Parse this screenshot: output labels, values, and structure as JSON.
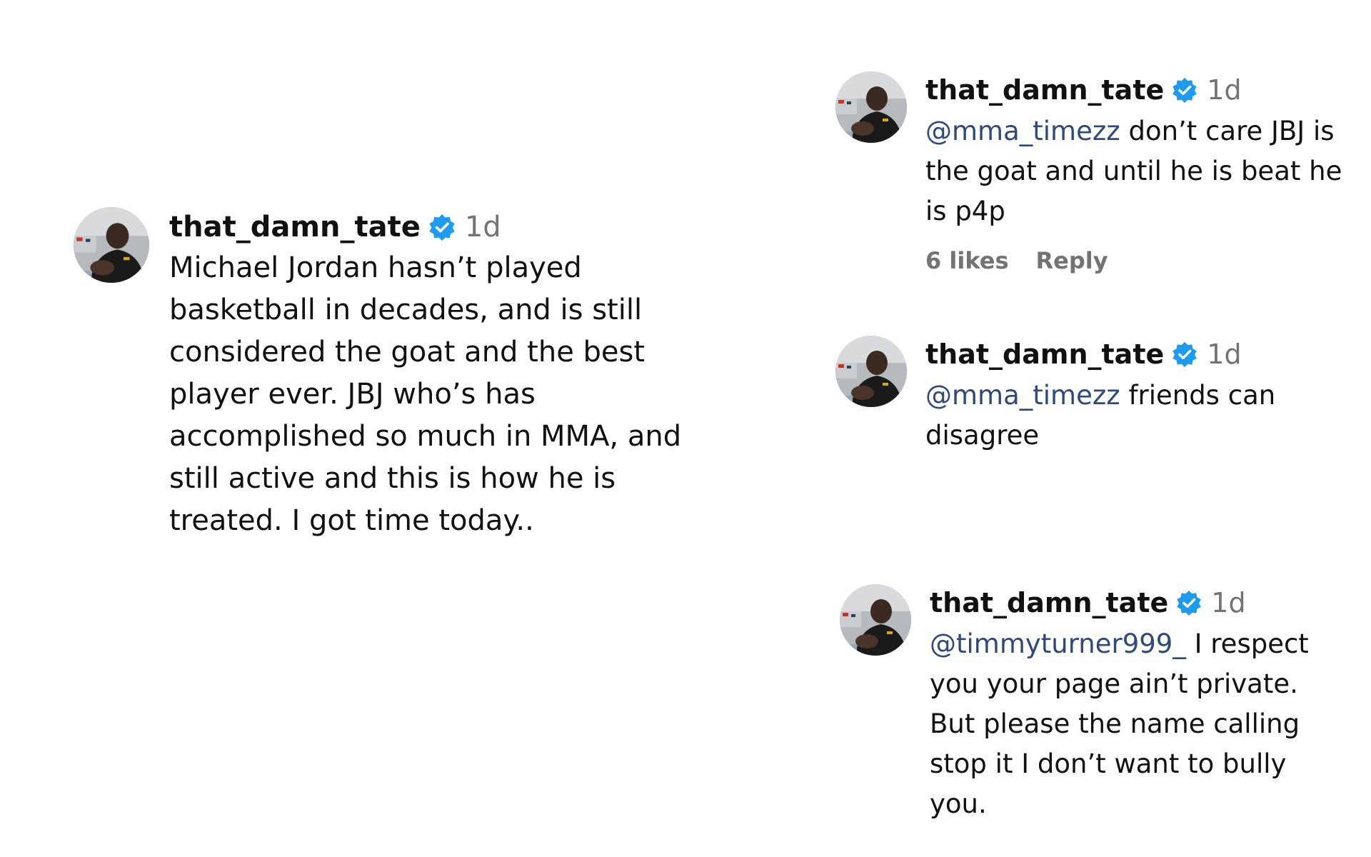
{
  "comments": [
    {
      "username": "that_damn_tate",
      "time": "1d",
      "mention": "",
      "text": "Michael Jordan hasn’t played basketball in decades, and is still considered the goat and the best player ever. JBJ who’s has accomplished so much in MMA, and still active and this is how he is treated. I got time today..",
      "likes": "",
      "reply": ""
    },
    {
      "username": "that_damn_tate",
      "time": "1d",
      "mention": "@mma_timezz",
      "text": " don’t care JBJ is the goat and until he is beat he is p4p",
      "likes": "6 likes",
      "reply": "Reply"
    },
    {
      "username": "that_damn_tate",
      "time": "1d",
      "mention": "@mma_timezz",
      "text": " friends can disagree",
      "likes": "",
      "reply": ""
    },
    {
      "username": "that_damn_tate",
      "time": "1d",
      "mention": "@timmyturner999_",
      "text": " I respect you your page ain’t private. But please the name calling stop it I don’t want to bully you.",
      "likes": "",
      "reply": ""
    }
  ],
  "colors": {
    "verified": "#1d9bf0",
    "mention": "#2f4a7a",
    "muted": "#737373",
    "text": "#111111"
  },
  "icons": {
    "verified": "verified-badge-icon",
    "avatar": "profile-photo"
  }
}
